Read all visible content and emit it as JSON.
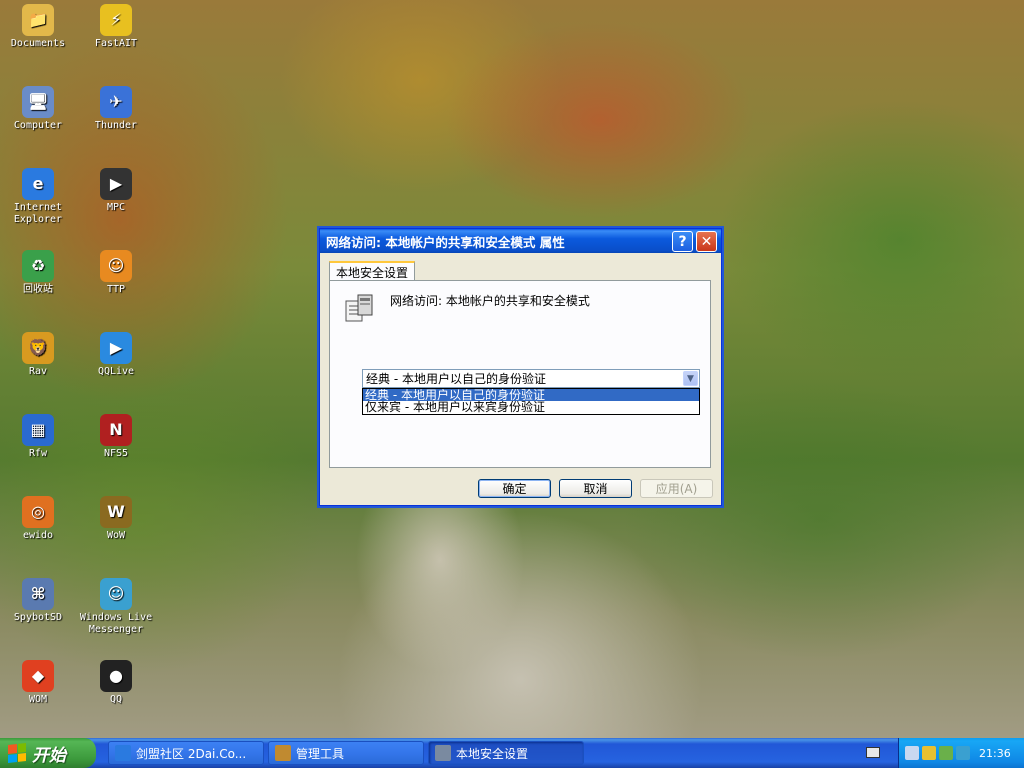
{
  "desktop": {
    "icons": [
      {
        "label1": "Documents",
        "label2": "",
        "glyph": "📁",
        "color": "#e2b84a"
      },
      {
        "label1": "FastAIT",
        "label2": "",
        "glyph": "⚡",
        "color": "#e8c020"
      },
      {
        "label1": "Computer",
        "label2": "",
        "glyph": "🖥",
        "color": "#6a8cc8"
      },
      {
        "label1": "Thunder",
        "label2": "",
        "glyph": "✈",
        "color": "#3a72d8"
      },
      {
        "label1": "Internet",
        "label2": "Explorer",
        "glyph": "e",
        "color": "#2a7ae0"
      },
      {
        "label1": "MPC",
        "label2": "",
        "glyph": "▶",
        "color": "#333333"
      },
      {
        "label1": "回收站",
        "label2": "",
        "glyph": "♻",
        "color": "#3aa04a"
      },
      {
        "label1": "TTP",
        "label2": "",
        "glyph": "☺",
        "color": "#e88a20"
      },
      {
        "label1": "Rav",
        "label2": "",
        "glyph": "🦁",
        "color": "#d89a20"
      },
      {
        "label1": "QQLive",
        "label2": "",
        "glyph": "▶",
        "color": "#2a8ae0"
      },
      {
        "label1": "Rfw",
        "label2": "",
        "glyph": "▦",
        "color": "#2a6ad0"
      },
      {
        "label1": "NFS5",
        "label2": "",
        "glyph": "N",
        "color": "#b02020"
      },
      {
        "label1": "ewido",
        "label2": "",
        "glyph": "◎",
        "color": "#e07020"
      },
      {
        "label1": "WoW",
        "label2": "",
        "glyph": "W",
        "color": "#8a6a20"
      },
      {
        "label1": "SpybotSD",
        "label2": "",
        "glyph": "⌘",
        "color": "#5a7ab0"
      },
      {
        "label1": "Windows Live",
        "label2": "Messenger",
        "glyph": "☺",
        "color": "#3aa0d0"
      },
      {
        "label1": "WOM",
        "label2": "",
        "glyph": "◆",
        "color": "#e04020"
      },
      {
        "label1": "QQ",
        "label2": "",
        "glyph": "●",
        "color": "#222222"
      }
    ]
  },
  "dialog": {
    "title": "网络访问: 本地帐户的共享和安全模式 属性",
    "help_glyph": "?",
    "close_glyph": "✕",
    "tab_label": "本地安全设置",
    "policy_name": "网络访问: 本地帐户的共享和安全模式",
    "combo_value": "经典 - 本地用户以自己的身份验证",
    "combo_arrow": "▼",
    "options": [
      "经典 - 本地用户以自己的身份验证",
      "仅来宾 - 本地用户以来宾身份验证"
    ],
    "ok_label": "确定",
    "cancel_label": "取消",
    "apply_label": "应用(A)"
  },
  "taskbar": {
    "start_label": "开始",
    "tasks": [
      {
        "label": "剑盟社区 2Dai.Co...",
        "color": "#2a7ae0"
      },
      {
        "label": "管理工具",
        "color": "#c08a30"
      },
      {
        "label": "本地安全设置",
        "color": "#7a8aa0"
      }
    ],
    "clock": "21:36"
  },
  "colors": {
    "accent": "#0a58e0",
    "selection": "#316ac5"
  }
}
